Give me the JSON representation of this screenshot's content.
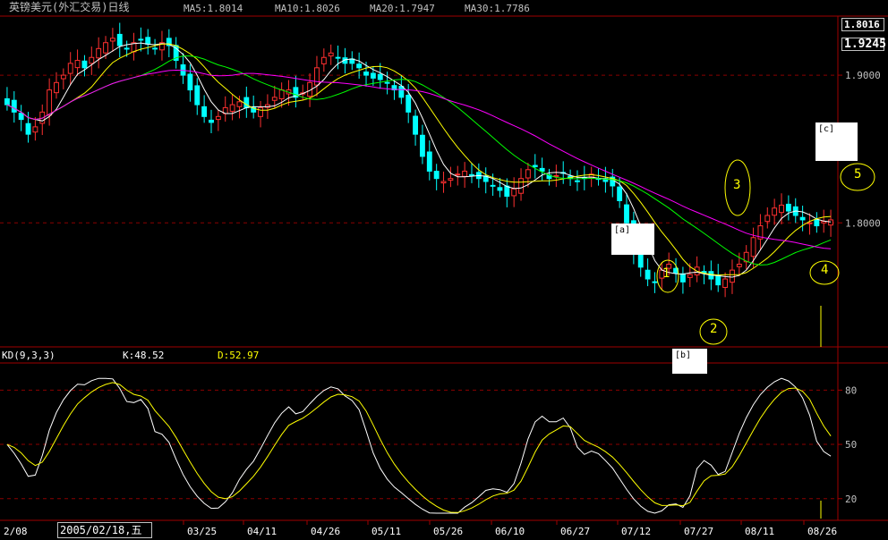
{
  "header": {
    "title": "英镑美元(外汇交易)日线",
    "ma5": "MA5:1.8014",
    "ma10": "MA10:1.8026",
    "ma20": "MA20:1.7947",
    "ma30": "MA30:1.7786"
  },
  "colors": {
    "title": "#ffff00",
    "ma5": "#ffffff",
    "ma10": "#ffff00",
    "ma20": "#00ff00",
    "ma30": "#ff00ff",
    "up_candle": "#ff3030",
    "down_candle": "#00ffff",
    "grid": "#8b0000",
    "axis": "#a00000"
  },
  "price_boxes": {
    "top": "1.8016",
    "current": "1.9245"
  },
  "kd": {
    "label": "KD(9,3,3)",
    "k": "K:48.52",
    "d": "D:52.97"
  },
  "annotations": {
    "a": "[a]",
    "b": "[b]",
    "c": "[c]",
    "wave_marks": [
      "1",
      "2",
      "3",
      "4",
      "5"
    ]
  },
  "cursor_date": "2005/02/18,五",
  "chart_data": [
    {
      "type": "candlestick",
      "title": "英镑美元(外汇交易)日线",
      "y_ticks": [
        "1.9000",
        "1.8000"
      ],
      "y_tick_values": [
        1.9,
        1.8
      ],
      "ylim": [
        1.716,
        1.94
      ],
      "x_ticks": [
        "2/08",
        "03/25",
        "04/11",
        "04/26",
        "05/11",
        "05/26",
        "06/10",
        "06/27",
        "07/12",
        "07/27",
        "08/11",
        "08/26"
      ],
      "grid": true,
      "close_series": [
        1.88,
        1.875,
        1.87,
        1.86,
        1.865,
        1.875,
        1.89,
        1.895,
        1.9,
        1.908,
        1.91,
        1.905,
        1.912,
        1.918,
        1.922,
        1.925,
        1.92,
        1.918,
        1.922,
        1.924,
        1.921,
        1.918,
        1.922,
        1.92,
        1.91,
        1.9,
        1.89,
        1.88,
        1.872,
        1.868,
        1.872,
        1.878,
        1.88,
        1.882,
        1.878,
        1.875,
        1.878,
        1.88,
        1.885,
        1.89,
        1.89,
        1.885,
        1.888,
        1.895,
        1.905,
        1.912,
        1.915,
        1.912,
        1.908,
        1.908,
        1.905,
        1.9,
        1.898,
        1.897,
        1.895,
        1.89,
        1.885,
        1.875,
        1.86,
        1.845,
        1.835,
        1.83,
        1.828,
        1.83,
        1.833,
        1.835,
        1.832,
        1.83,
        1.828,
        1.825,
        1.822,
        1.818,
        1.823,
        1.83,
        1.836,
        1.838,
        1.835,
        1.83,
        1.832,
        1.834,
        1.83,
        1.828,
        1.83,
        1.833,
        1.83,
        1.828,
        1.825,
        1.815,
        1.8,
        1.78,
        1.77,
        1.762,
        1.76,
        1.768,
        1.772,
        1.766,
        1.76,
        1.765,
        1.77,
        1.766,
        1.762,
        1.758,
        1.762,
        1.768,
        1.772,
        1.78,
        1.79,
        1.798,
        1.805,
        1.81,
        1.812,
        1.808,
        1.805,
        1.802,
        1.8,
        1.798,
        1.801,
        1.802
      ],
      "ma_series": [
        {
          "name": "MA5",
          "last": 1.8014
        },
        {
          "name": "MA10",
          "last": 1.8026
        },
        {
          "name": "MA20",
          "last": 1.7947
        },
        {
          "name": "MA30",
          "last": 1.7786
        }
      ]
    },
    {
      "type": "line",
      "title": "KD(9,3,3)",
      "y_ticks": [
        "80",
        "50",
        "20"
      ],
      "y_tick_values": [
        80,
        50,
        20
      ],
      "ylim": [
        10,
        95
      ],
      "series": [
        {
          "name": "K",
          "last": 48.52
        },
        {
          "name": "D",
          "last": 52.97
        }
      ]
    }
  ]
}
